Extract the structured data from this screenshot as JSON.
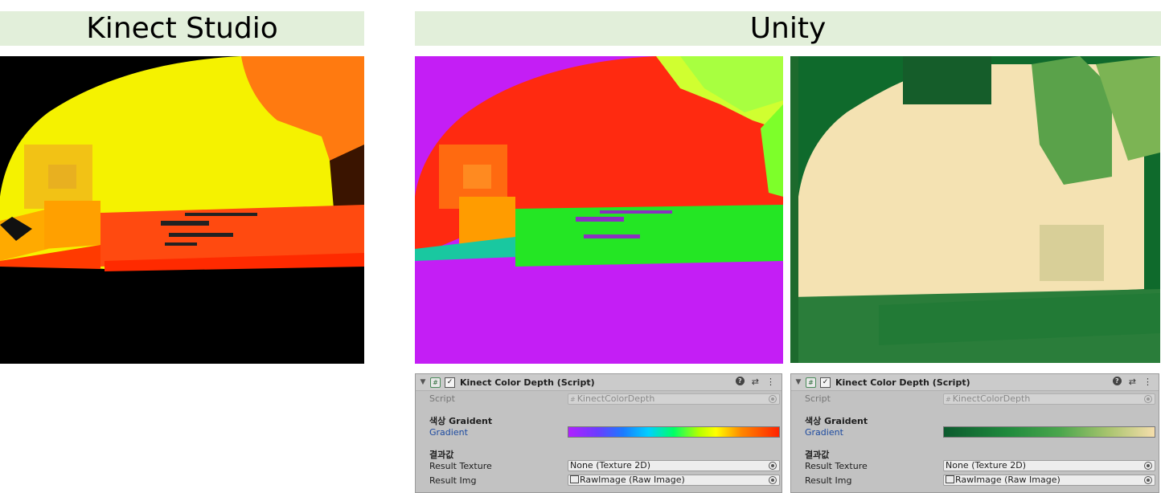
{
  "banners": {
    "left": "Kinect Studio",
    "right": "Unity"
  },
  "inspector_left": {
    "component_title": "Kinect Color Depth (Script)",
    "script_label": "Script",
    "script_value": "KinectColorDepth",
    "gradient_header": "색상 Graident",
    "gradient_label": "Gradient",
    "result_header": "결과값",
    "result_texture_label": "Result Texture",
    "result_texture_value": "None (Texture 2D)",
    "result_img_label": "Result Img",
    "result_img_value": "RawImage (Raw Image)",
    "gradient_colors": [
      "#b020ff",
      "#1a7bff",
      "#00ff66",
      "#ffff00",
      "#ff2200"
    ]
  },
  "inspector_right": {
    "component_title": "Kinect Color Depth (Script)",
    "script_label": "Script",
    "script_value": "KinectColorDepth",
    "gradient_header": "색상 Graident",
    "gradient_label": "Gradient",
    "result_header": "결과값",
    "result_texture_label": "Result Texture",
    "result_texture_value": "None (Texture 2D)",
    "result_img_label": "Result Img",
    "result_img_value": "RawImage (Raw Image)",
    "gradient_colors": [
      "#0c5a2e",
      "#4aa64d",
      "#f5deac"
    ]
  },
  "icons": {
    "fold": "triangle-down-icon",
    "script": "script-hash-icon",
    "enabled": "checkbox-checked-icon",
    "help": "help-icon",
    "presets": "presets-icon",
    "menu": "kebab-menu-icon",
    "object_picker": "object-picker-icon",
    "raw_image": "raw-image-icon"
  },
  "colors": {
    "banner_bg": "#e2efda",
    "inspector_bg": "#c2c2c2",
    "link_blue": "#1c4aa0"
  }
}
